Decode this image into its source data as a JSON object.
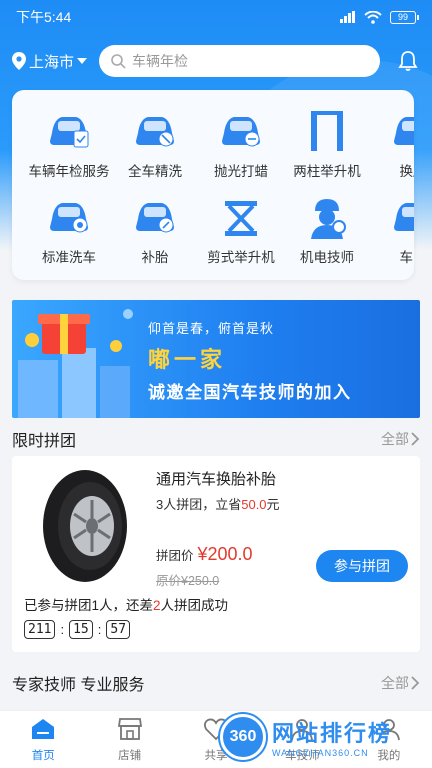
{
  "status": {
    "time": "下午5:44",
    "battery": "99"
  },
  "header": {
    "city": "上海市",
    "search_placeholder": "车辆年检"
  },
  "services": [
    {
      "label": "车辆年检服务",
      "icon": "car-inspection-icon"
    },
    {
      "label": "全车精洗",
      "icon": "car-wash-icon"
    },
    {
      "label": "抛光打蜡",
      "icon": "polish-icon"
    },
    {
      "label": "两柱举升机",
      "icon": "two-post-lift-icon"
    },
    {
      "label": "换胎",
      "icon": "tire-change-icon"
    },
    {
      "label": "标准洗车",
      "icon": "standard-wash-icon"
    },
    {
      "label": "补胎",
      "icon": "tire-repair-icon"
    },
    {
      "label": "剪式举升机",
      "icon": "scissor-lift-icon"
    },
    {
      "label": "机电技师",
      "icon": "technician-icon"
    },
    {
      "label": "车险",
      "icon": "car-insurance-icon"
    }
  ],
  "banner": {
    "line1": "仰首是春，俯首是秋",
    "line2": "嘟一家",
    "line3": "诚邀全国汽车技师的加入"
  },
  "group_section": {
    "title": "限时拼团",
    "more": "全部"
  },
  "group_item": {
    "name": "通用汽车换胎补胎",
    "sub_prefix": "3人拼团，立省",
    "sub_amount": "50.0",
    "sub_suffix": "元",
    "price_label": "拼团价",
    "price": "¥200.0",
    "orig_price": "原价¥250.0",
    "join_label": "参与拼团",
    "progress_prefix": "已参与拼团1人，还差",
    "progress_count": "2",
    "progress_suffix": "人拼团成功",
    "timer": [
      "211",
      "15",
      "57"
    ]
  },
  "expert_section": {
    "title": "专家技师 专业服务",
    "more": "全部"
  },
  "tabs": [
    {
      "label": "首页",
      "active": true
    },
    {
      "label": "店铺",
      "active": false
    },
    {
      "label": "共享",
      "active": false
    },
    {
      "label": "车技师",
      "active": false
    },
    {
      "label": "我的",
      "active": false
    }
  ],
  "watermark": {
    "badge": "360",
    "main": "网站排行榜",
    "sub": "WANGZHAN360.CN"
  },
  "colors": {
    "primary": "#1e86f0",
    "price_red": "#e23b2e",
    "accent_yellow": "#ffd33b"
  }
}
